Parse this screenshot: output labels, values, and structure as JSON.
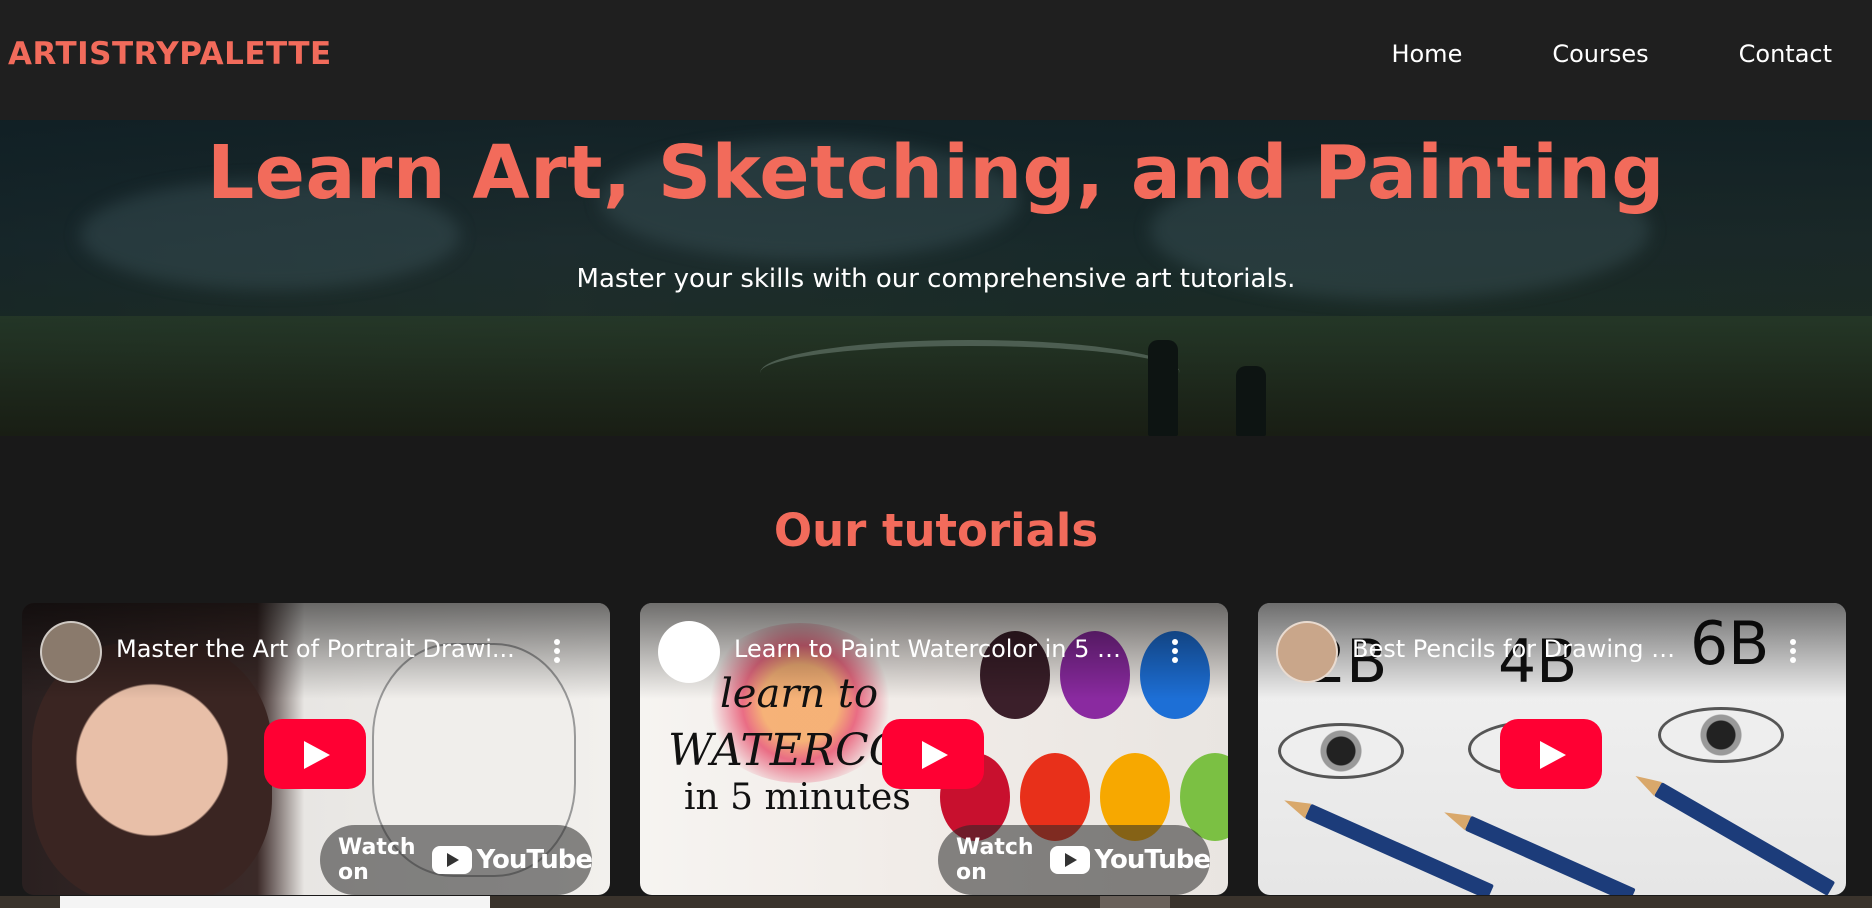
{
  "nav": {
    "logo": "ARTISTRYPALETTE",
    "links": [
      "Home",
      "Courses",
      "Contact"
    ]
  },
  "hero": {
    "title": "Learn Art, Sketching, and Painting",
    "subtitle": "Master your skills with our comprehensive art tutorials."
  },
  "tutorials": {
    "heading": "Our tutorials",
    "videos": [
      {
        "title": "Master the Art of Portrait Drawi...",
        "watch_label": "Watch on",
        "brand": "YouTube"
      },
      {
        "title": "Learn to Paint Watercolor in 5 M...",
        "watch_label": "Watch on",
        "brand": "YouTube",
        "thumb_text_1": "learn to",
        "thumb_text_2": "WATERCOLO",
        "thumb_text_3": "in 5 minutes"
      },
      {
        "title": "Best Pencils for Drawing - ...",
        "thumb_labels": [
          "2B",
          "4B",
          "6B"
        ]
      }
    ]
  },
  "colors": {
    "accent": "#f26b5b",
    "background": "#191919",
    "nav_background": "#1f1f1f",
    "youtube_red": "#ff0033"
  }
}
